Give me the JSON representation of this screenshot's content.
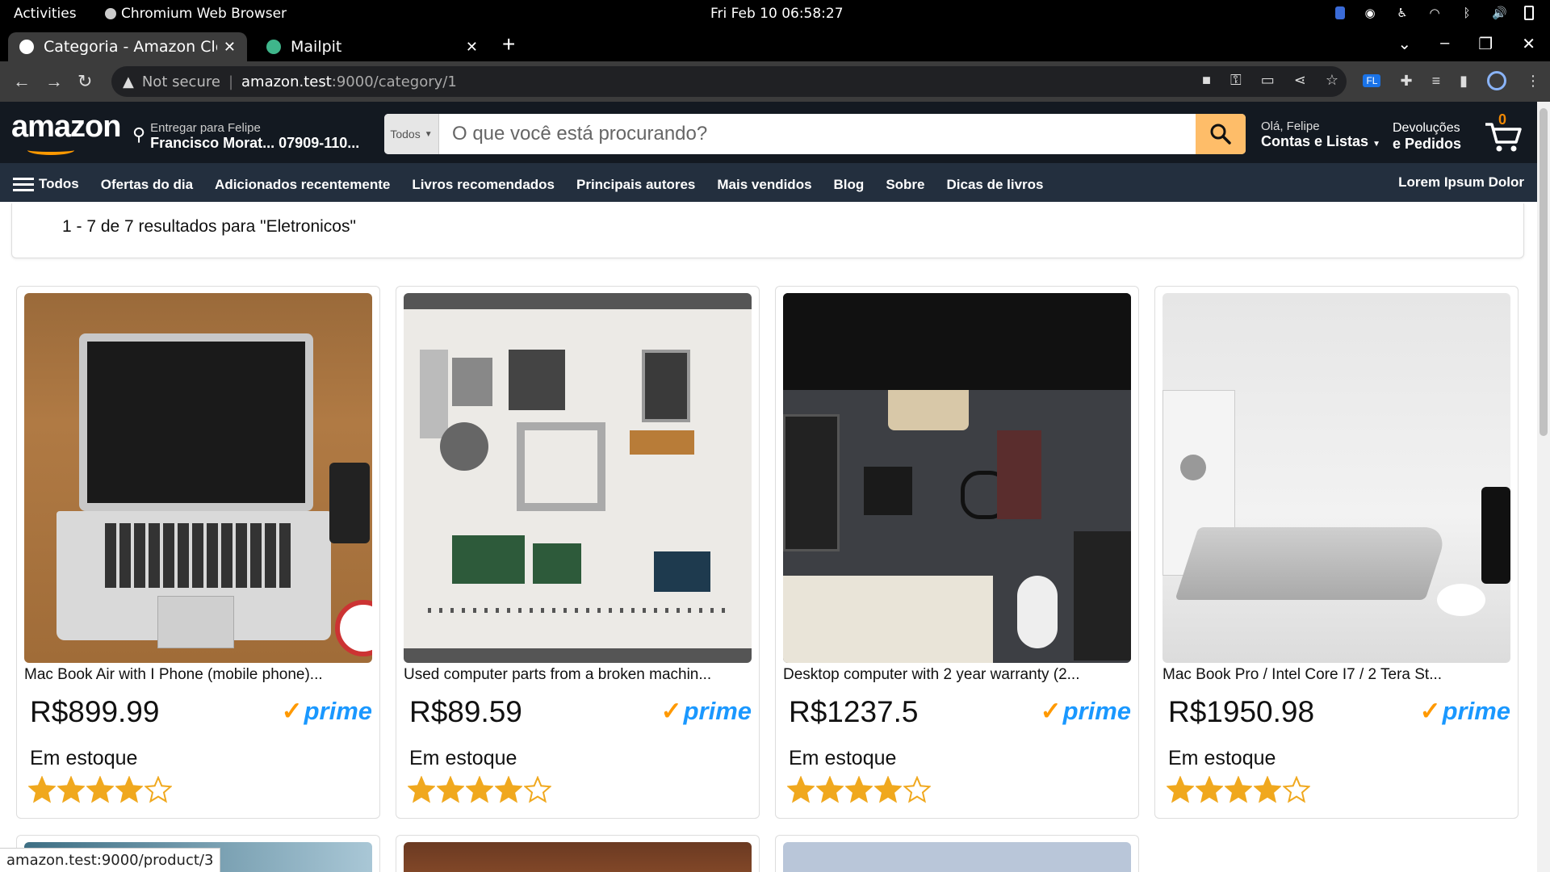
{
  "system": {
    "activities": "Activities",
    "app_name": "Chromium Web Browser",
    "clock": "Fri Feb 10  06:58:27"
  },
  "browser": {
    "tabs": [
      {
        "title": "Categoria - Amazon Clone",
        "active": true
      },
      {
        "title": "Mailpit",
        "active": false
      }
    ],
    "security": "Not secure",
    "url_host": "amazon.test",
    "url_path": ":9000/category/1",
    "status_url": "amazon.test:9000/product/3"
  },
  "header": {
    "logo": "amazon",
    "deliver_label": "Entregar para Felipe",
    "deliver_address": "Francisco Morat... 07909-110...",
    "search_category": "Todos",
    "search_placeholder": "O que você está procurando?",
    "greeting": "Olá, Felipe",
    "account": "Contas e Listas",
    "returns_l1": "Devoluções",
    "returns_l2": "e Pedidos",
    "cart_count": "0"
  },
  "nav": {
    "all": "Todos",
    "items": [
      "Ofertas do dia",
      "Adicionados recentemente",
      "Livros recomendados",
      "Principais autores",
      "Mais vendidos",
      "Blog",
      "Sobre",
      "Dicas de livros"
    ],
    "right": "Lorem Ipsum Dolor"
  },
  "results_text": "1 - 7 de 7 resultados para \"Eletronicos\"",
  "products": [
    {
      "name": "Mac Book Air with I Phone (mobile phone)...",
      "price": "R$899.99",
      "prime": "prime",
      "stock": "Em estoque",
      "rating": 4
    },
    {
      "name": "Used computer parts from a broken machin...",
      "price": "R$89.59",
      "prime": "prime",
      "stock": "Em estoque",
      "rating": 4
    },
    {
      "name": "Desktop computer with 2 year warranty (2...",
      "price": "R$1237.5",
      "prime": "prime",
      "stock": "Em estoque",
      "rating": 4
    },
    {
      "name": "Mac Book Pro / Intel Core I7 / 2 Tera St...",
      "price": "R$1950.98",
      "prime": "prime",
      "stock": "Em estoque",
      "rating": 4
    }
  ],
  "colors": {
    "star": "#f0a81e",
    "prime": "#1a98ff",
    "search_button": "#febd69",
    "header_bg": "#131921",
    "nav_bg": "#232f3e"
  }
}
